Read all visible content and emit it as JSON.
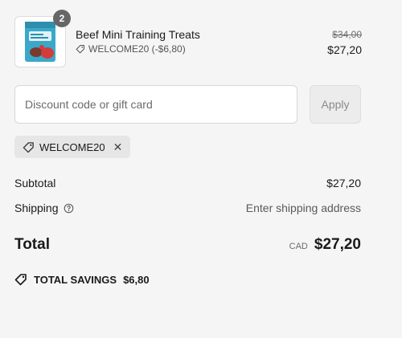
{
  "cart": {
    "item": {
      "quantity": "2",
      "title": "Beef Mini Training Treats",
      "discount_line": "WELCOME20 (-$6,80)",
      "original_price": "$34,00",
      "price": "$27,20",
      "thumbnail_icon": "product-bag-icon"
    }
  },
  "discount": {
    "placeholder": "Discount code or gift card",
    "value": "",
    "apply_label": "Apply",
    "applied_code": "WELCOME20",
    "remove_icon": "close-icon",
    "tag_icon": "tag-icon"
  },
  "summary": {
    "subtotal_label": "Subtotal",
    "subtotal_value": "$27,20",
    "shipping_label": "Shipping",
    "shipping_help_icon": "help-icon",
    "shipping_value": "Enter shipping address",
    "total_label": "Total",
    "currency": "CAD",
    "total_value": "$27,20",
    "savings_label": "TOTAL SAVINGS",
    "savings_value": "$6,80",
    "savings_icon": "tag-icon"
  },
  "colors": {
    "page_background": "#f5f5f5",
    "badge_background": "#666666",
    "chip_background": "#e6e6e6",
    "button_background": "#ececec"
  }
}
